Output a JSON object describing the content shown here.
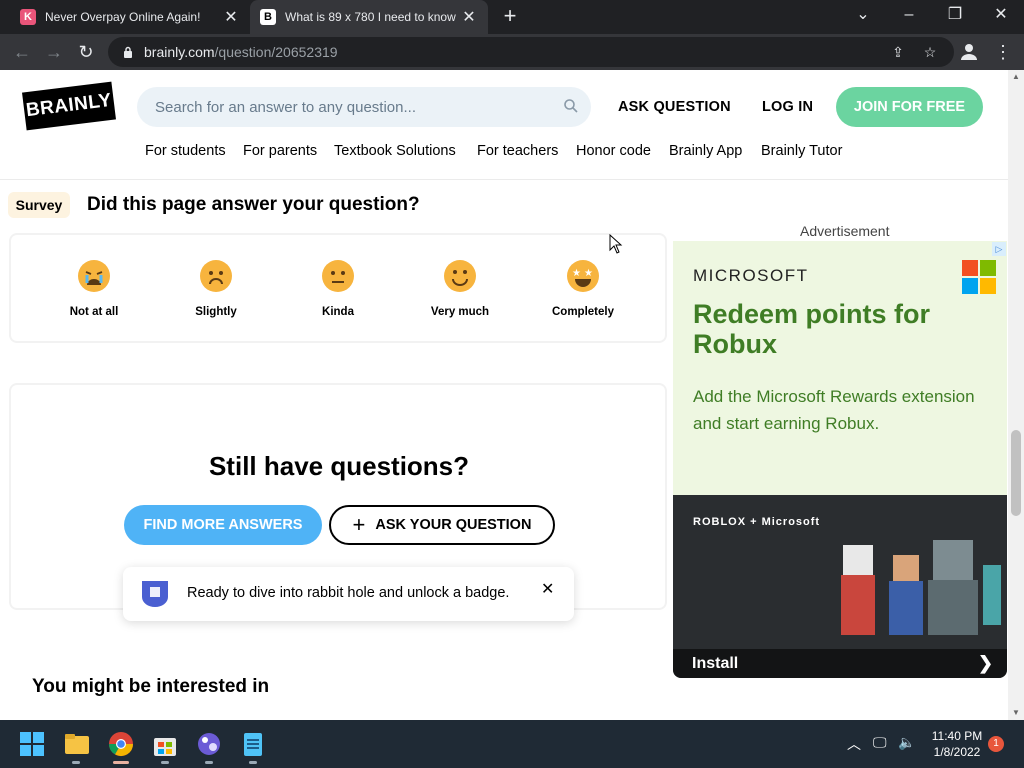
{
  "browser": {
    "tabs": [
      {
        "title": "Never Overpay Online Again!",
        "favicon": "K",
        "favicon_color": "#e9557a"
      },
      {
        "title": "What is 89 x 780 I need to know",
        "favicon": "B",
        "favicon_color": "#000000"
      }
    ],
    "url_host": "brainly.com",
    "url_path": "/question/20652319"
  },
  "header": {
    "logo_text": "BRAINLY",
    "search_placeholder": "Search for an answer to any question...",
    "ask_question": "ASK QUESTION",
    "log_in": "LOG IN",
    "join": "JOIN FOR FREE"
  },
  "nav": [
    "For students",
    "For parents",
    "Textbook Solutions",
    "For teachers",
    "Honor code",
    "Brainly App",
    "Brainly Tutor"
  ],
  "survey": {
    "badge": "Survey",
    "question": "Did this page answer your question?",
    "options": [
      "Not at all",
      "Slightly",
      "Kinda",
      "Very much",
      "Completely"
    ]
  },
  "ask": {
    "title": "Still have questions?",
    "find_more": "FIND MORE ANSWERS",
    "ask_your": "ASK YOUR QUESTION"
  },
  "toast": {
    "message": "Ready to dive into rabbit hole and unlock a badge."
  },
  "interest": "You might be interested in",
  "ad": {
    "label": "Advertisement",
    "brand": "MICROSOFT",
    "headline": "Redeem points for Robux",
    "body": "Add the Microsoft Rewards extension and start earning Robux.",
    "image_text": "ROBLOX + Microsoft",
    "cta": "Install",
    "text_color": "#3f7d25",
    "bg_color": "#eef7e1"
  },
  "taskbar": {
    "time": "11:40 PM",
    "date": "1/8/2022",
    "notifications": "1"
  },
  "colors": {
    "join": "#6bd4a0",
    "find_more": "#4fb3f6",
    "search_bg": "#ebf2f7",
    "survey_badge_bg": "#fdf3e0"
  }
}
